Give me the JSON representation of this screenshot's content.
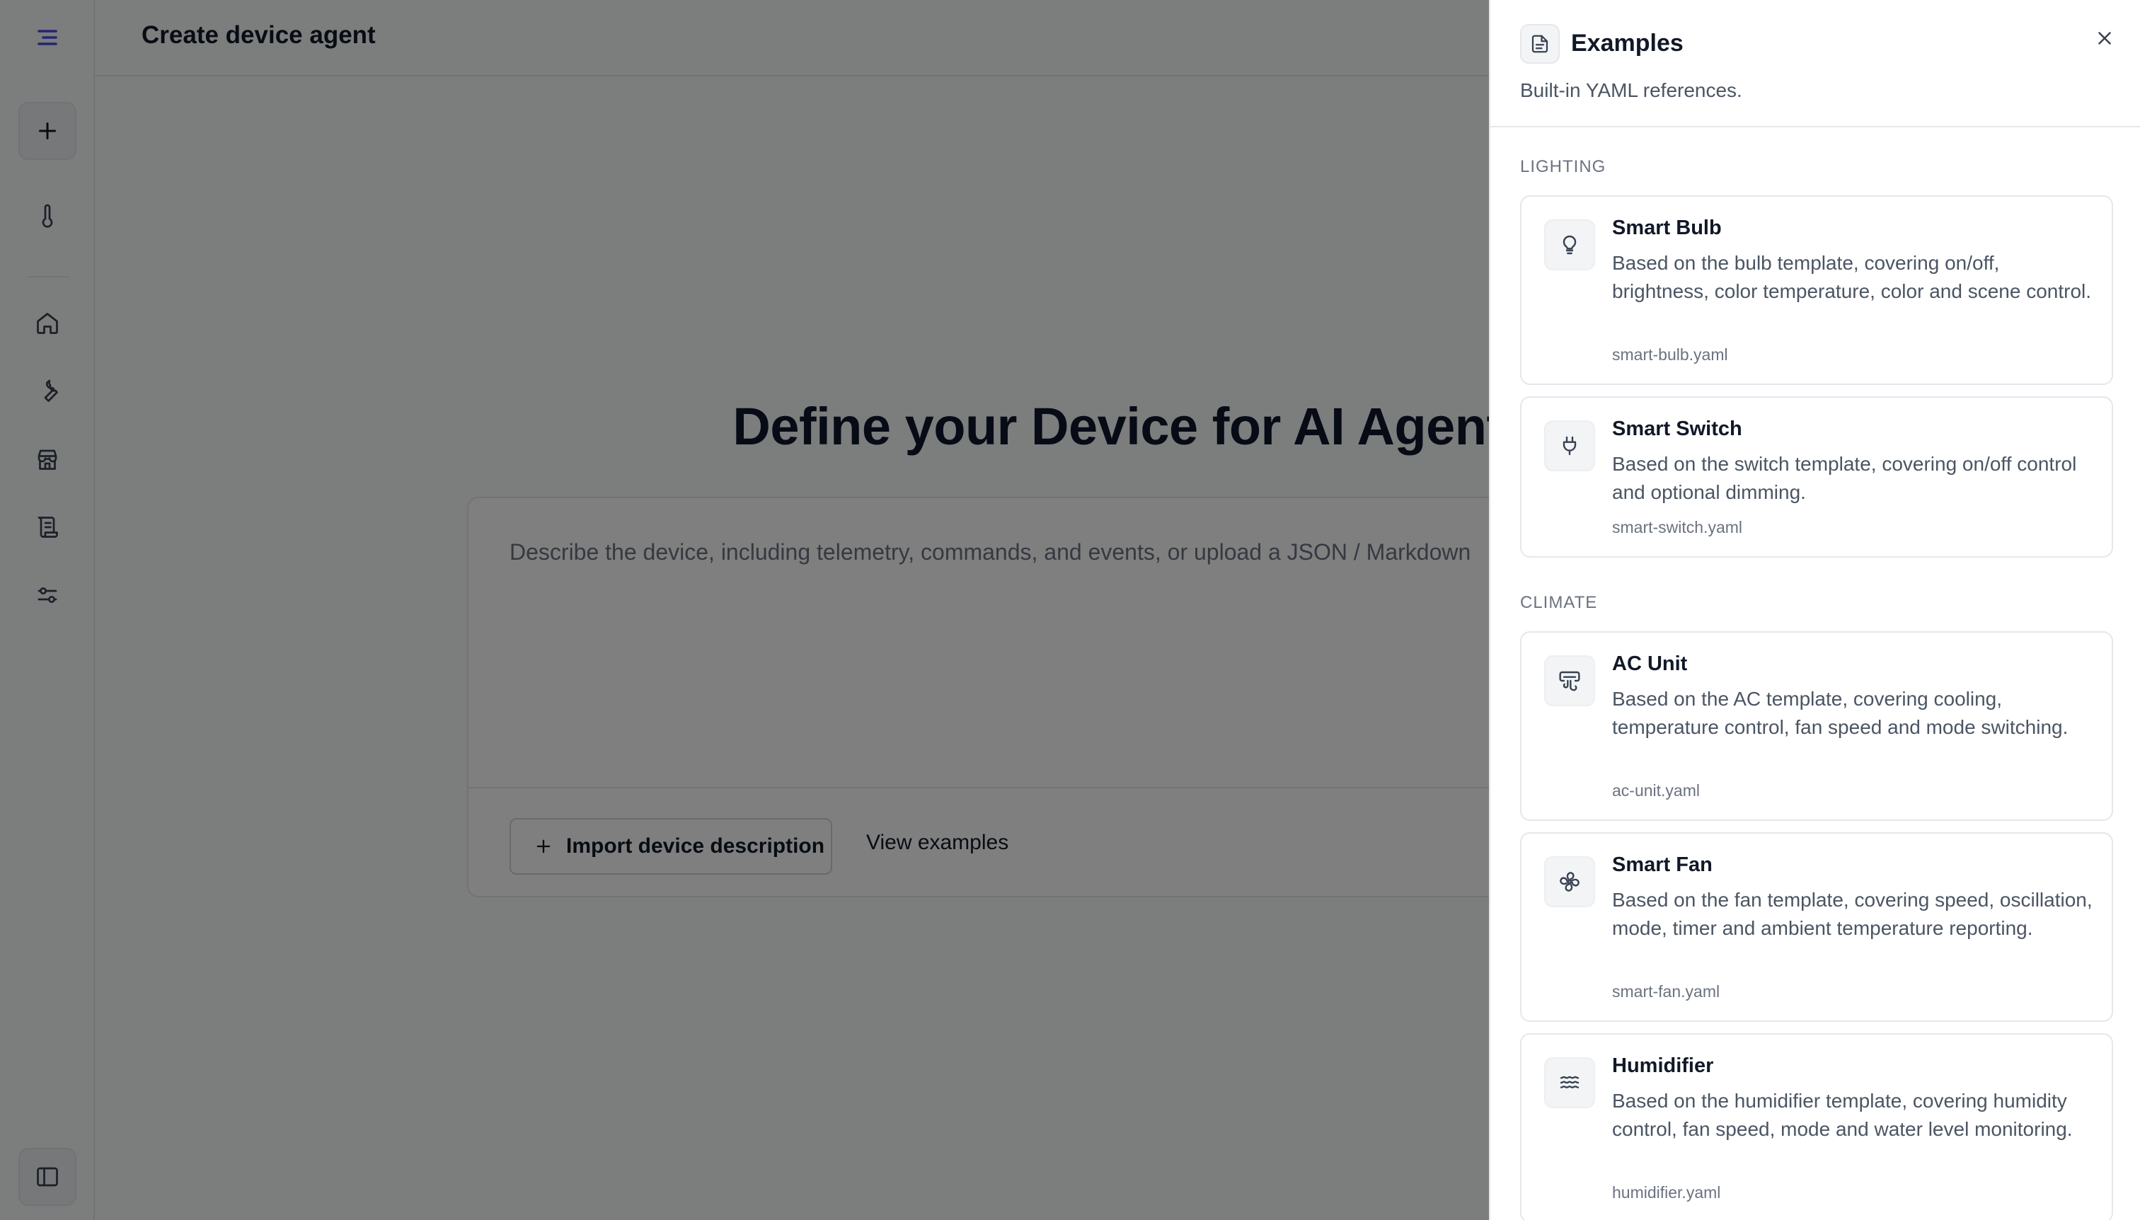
{
  "page": {
    "title": "Create device agent"
  },
  "sidebar": {
    "items": [
      {
        "name": "menu-icon"
      },
      {
        "name": "plus-icon"
      },
      {
        "name": "thermometer-icon"
      },
      {
        "name": "home-icon"
      },
      {
        "name": "wrench-icon"
      },
      {
        "name": "store-icon"
      },
      {
        "name": "scroll-icon"
      },
      {
        "name": "sliders-icon"
      },
      {
        "name": "sidebar-toggle-icon"
      }
    ]
  },
  "main": {
    "hero": "Define your Device for AI Agent",
    "input_placeholder": "Describe the device, including telemetry, commands, and events, or upload a JSON / Markdown",
    "import_label": "Import device description",
    "view_examples_label": "View examples"
  },
  "panel": {
    "title": "Examples",
    "subtitle": "Built-in YAML references.",
    "sections": [
      {
        "label": "LIGHTING",
        "items": [
          {
            "title": "Smart Bulb",
            "desc": "Based on the bulb template, covering on/off, brightness, color temperature, color and scene control.",
            "file": "smart-bulb.yaml",
            "icon": "lightbulb-icon"
          },
          {
            "title": "Smart Switch",
            "desc": "Based on the switch template, covering on/off control and optional dimming.",
            "file": "smart-switch.yaml",
            "icon": "plug-icon"
          }
        ]
      },
      {
        "label": "CLIMATE",
        "items": [
          {
            "title": "AC Unit",
            "desc": "Based on the AC template, covering cooling, temperature control, fan speed and mode switching.",
            "file": "ac-unit.yaml",
            "icon": "air-vent-icon"
          },
          {
            "title": "Smart Fan",
            "desc": "Based on the fan template, covering speed, oscillation, mode, timer and ambient temperature reporting.",
            "file": "smart-fan.yaml",
            "icon": "fan-icon"
          },
          {
            "title": "Humidifier",
            "desc": "Based on the humidifier template, covering humidity control, fan speed, mode and water level monitoring.",
            "file": "humidifier.yaml",
            "icon": "waves-icon"
          }
        ]
      }
    ]
  },
  "colors": {
    "accent": "#4f46e5",
    "overlay": "#000000"
  }
}
